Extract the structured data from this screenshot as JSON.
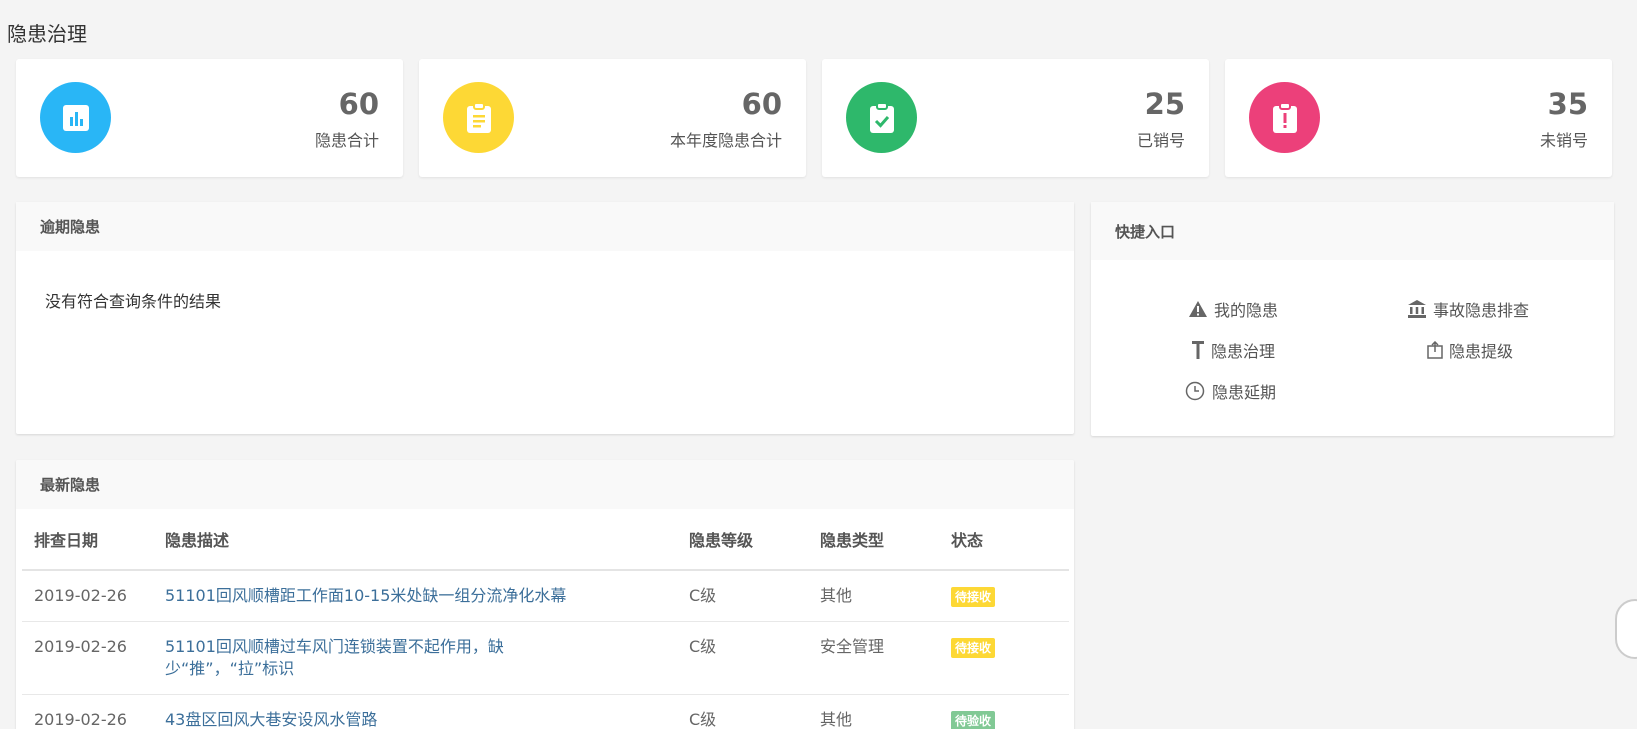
{
  "page": {
    "title": "隐患治理"
  },
  "stats": [
    {
      "value": "60",
      "label": "隐患合计",
      "color": "#29b6f6",
      "icon": "bar-chart-icon"
    },
    {
      "value": "60",
      "label": "本年度隐患合计",
      "color": "#fdd835",
      "icon": "clipboard-list-icon"
    },
    {
      "value": "25",
      "label": "已销号",
      "color": "#2eb86b",
      "icon": "clipboard-check-icon"
    },
    {
      "value": "35",
      "label": "未销号",
      "color": "#ec407a",
      "icon": "clipboard-alert-icon"
    }
  ],
  "overdue": {
    "title": "逾期隐患",
    "empty_text": "没有符合查询条件的结果"
  },
  "quick": {
    "title": "快捷入口",
    "links": [
      {
        "label": "我的隐患",
        "icon": "warning-icon"
      },
      {
        "label": "事故隐患排查",
        "icon": "institution-icon"
      },
      {
        "label": "隐患治理",
        "icon": "text-height-icon"
      },
      {
        "label": "隐患提级",
        "icon": "share-icon"
      },
      {
        "label": "隐患延期",
        "icon": "clock-icon"
      }
    ]
  },
  "latest": {
    "title": "最新隐患",
    "columns": [
      "排查日期",
      "隐患描述",
      "隐患等级",
      "隐患类型",
      "状态"
    ],
    "rows": [
      {
        "date": "2019-02-26",
        "desc": "51101回风顺槽距工作面10-15米处缺一组分流净化水幕",
        "level": "C级",
        "type": "其他",
        "status": "待接收",
        "status_color": "#fdd835"
      },
      {
        "date": "2019-02-26",
        "desc": "51101回风顺槽过车风门连锁装置不起作用，缺少“推”，“拉”标识",
        "level": "C级",
        "type": "安全管理",
        "status": "待接收",
        "status_color": "#fdd835"
      },
      {
        "date": "2019-02-26",
        "desc": "43盘区回风大巷安设风水管路",
        "level": "C级",
        "type": "其他",
        "status": "待验收",
        "status_color": "#81c995"
      }
    ]
  }
}
